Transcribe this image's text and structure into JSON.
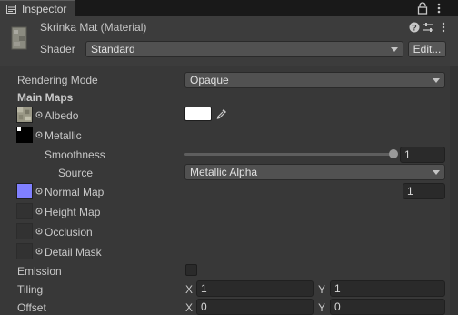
{
  "tab": {
    "label": "Inspector"
  },
  "header": {
    "title": "Skrinka Mat (Material)",
    "shader_label": "Shader",
    "shader_value": "Standard",
    "edit_label": "Edit..."
  },
  "props": {
    "rendering_mode_label": "Rendering Mode",
    "rendering_mode_value": "Opaque",
    "main_maps_label": "Main Maps",
    "albedo_label": "Albedo",
    "albedo_color": "#ffffff",
    "metallic_label": "Metallic",
    "smoothness_label": "Smoothness",
    "smoothness_value": "1",
    "smoothness_fraction": 1.0,
    "source_label": "Source",
    "source_value": "Metallic Alpha",
    "normal_map_label": "Normal Map",
    "normal_map_value": "1",
    "normal_map_color": "#8080ff",
    "height_map_label": "Height Map",
    "occlusion_label": "Occlusion",
    "detail_mask_label": "Detail Mask",
    "emission_label": "Emission",
    "tiling_label": "Tiling",
    "tiling_x_label": "X",
    "tiling_x": "1",
    "tiling_y_label": "Y",
    "tiling_y": "1",
    "offset_label": "Offset",
    "offset_x_label": "X",
    "offset_x": "0",
    "offset_y_label": "Y",
    "offset_y": "0"
  },
  "icons": [
    "inspector-tab-icon",
    "lock-icon",
    "kebab-menu-icon",
    "help-icon",
    "preset-icon",
    "more-icon",
    "eyedropper-icon",
    "dropdown-caret-icon",
    "texture-slot-dot-icon"
  ],
  "colors": {
    "panel": "#383838",
    "field": "#2a2a2a",
    "dropdown": "#515151",
    "normal_map": "#8080ff"
  }
}
